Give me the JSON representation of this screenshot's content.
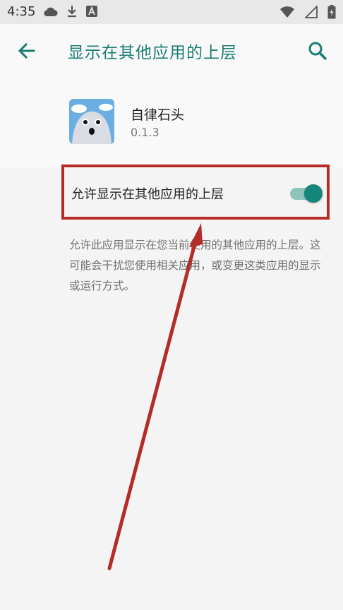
{
  "status_bar": {
    "time": "4:35",
    "left_icons": [
      "cloud-icon",
      "download-icon",
      "a-badge-icon"
    ],
    "right_icons": [
      "wifi-icon",
      "signal-icon",
      "battery-icon"
    ]
  },
  "app_bar": {
    "title": "显示在其他应用的上层",
    "back_icon": "arrow-left-icon",
    "search_icon": "search-icon",
    "accent_color": "#1a7d72"
  },
  "app_info": {
    "name": "自律石头",
    "version": "0.1.3"
  },
  "setting": {
    "label": "允许显示在其他应用的上层",
    "enabled": true,
    "toggle_color": "#15877a"
  },
  "description": "允许此应用显示在您当前使用的其他应用的上层。这可能会干扰您使用相关应用，或变更这类应用的显示或运行方式。",
  "annotation": {
    "highlight_color": "#b52b27"
  }
}
